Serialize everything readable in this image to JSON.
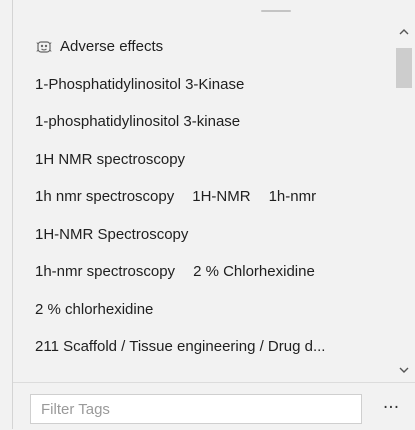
{
  "tag_list": {
    "items": [
      {
        "icon": "tag-group-icon",
        "tags": [
          "Adverse effects"
        ]
      },
      {
        "tags": [
          "1-Phosphatidylinositol 3-Kinase"
        ]
      },
      {
        "tags": [
          "1-phosphatidylinositol 3-kinase"
        ]
      },
      {
        "tags": [
          "1H NMR spectroscopy"
        ]
      },
      {
        "tags": [
          "1h nmr spectroscopy",
          "1H-NMR",
          "1h-nmr"
        ]
      },
      {
        "tags": [
          "1H-NMR Spectroscopy"
        ]
      },
      {
        "tags": [
          "1h-nmr spectroscopy",
          "2 % Chlorhexidine"
        ]
      },
      {
        "tags": [
          "2 % chlorhexidine"
        ]
      },
      {
        "tags": [
          "211 Scaffold / Tissue engineering / Drug d..."
        ]
      }
    ]
  },
  "scrollbar": {
    "up_icon": "chevron-up-icon",
    "down_icon": "chevron-down-icon"
  },
  "footer": {
    "filter_placeholder": "Filter Tags",
    "filter_value": "",
    "more_label": "···"
  },
  "colors": {
    "panel_background": "#f2f2f2",
    "text": "#1f1f1f",
    "scroll_thumb": "#cdcdcd"
  }
}
